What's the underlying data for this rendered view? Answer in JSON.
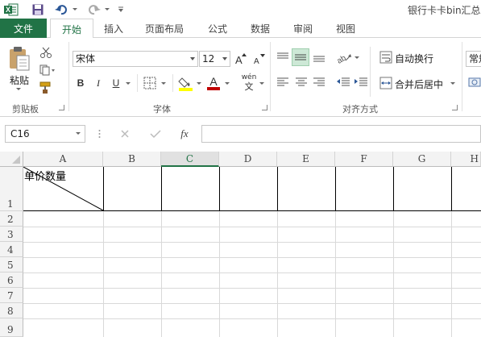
{
  "title_bar": {
    "title": "银行卡卡bin汇总",
    "icons": [
      "excel-logo-icon",
      "save-icon",
      "undo-icon",
      "redo-icon",
      "customize-qat-icon"
    ]
  },
  "tabs": {
    "file": "文件",
    "items": [
      "开始",
      "插入",
      "页面布局",
      "公式",
      "数据",
      "审阅",
      "视图"
    ],
    "active": "开始"
  },
  "ribbon": {
    "clipboard": {
      "paste": "粘贴",
      "label": "剪贴板"
    },
    "font": {
      "family": "宋体",
      "size": "12",
      "bold": "B",
      "italic": "I",
      "underline": "U",
      "wen": "wén",
      "wen_char": "文",
      "color_a": "A",
      "label": "字体"
    },
    "alignment": {
      "wrap": "自动换行",
      "merge": "合并后居中",
      "label": "对齐方式"
    },
    "number": {
      "format_partial": "常规"
    }
  },
  "formula_bar": {
    "name_box": "C16",
    "fx": "fx",
    "content": ""
  },
  "sheet": {
    "columns": [
      "A",
      "B",
      "C",
      "D",
      "E",
      "F",
      "G"
    ],
    "active_column": "C",
    "rows": [
      "1",
      "2",
      "3",
      "4",
      "5",
      "6",
      "7",
      "8",
      "9"
    ],
    "cell_a1": "单价数量"
  },
  "colors": {
    "accent": "#217346",
    "selection": "#cde8d6"
  }
}
